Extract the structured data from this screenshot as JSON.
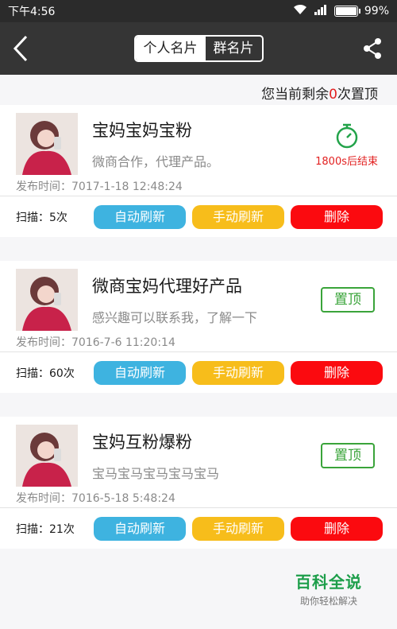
{
  "status": {
    "time": "下午4:56",
    "battery": "99%",
    "battery_level": 0.99
  },
  "header": {
    "tabs": [
      "个人名片",
      "群名片"
    ],
    "active_tab": 0
  },
  "remain": {
    "prefix": "您当前剩余",
    "count": "0",
    "suffix": "次置顶"
  },
  "cards": [
    {
      "title": "宝妈宝妈宝粉",
      "subtitle": "微商合作，代理产品。",
      "pub_time": "发布时间：7017-1-18    12:48:24",
      "scan": "扫描：5次",
      "timer_text": "1800s后结束"
    },
    {
      "title": "微商宝妈代理好产品",
      "subtitle": "感兴趣可以联系我，了解一下",
      "pub_time": "发布时间：7016-7-6    11:20:14",
      "scan": "扫描：60次",
      "pin_label": "置顶"
    },
    {
      "title": "宝妈互粉爆粉",
      "subtitle": "宝马宝马宝马宝马宝马",
      "pub_time": "发布时间：7016-5-18    5:48:24",
      "scan": "扫描：21次",
      "pin_label": "置顶"
    }
  ],
  "buttons": {
    "auto_refresh": "自动刷新",
    "manual_refresh": "手动刷新",
    "delete": "删除"
  },
  "watermark": {
    "title": "百科全说",
    "subtitle": "助你轻松解决"
  }
}
